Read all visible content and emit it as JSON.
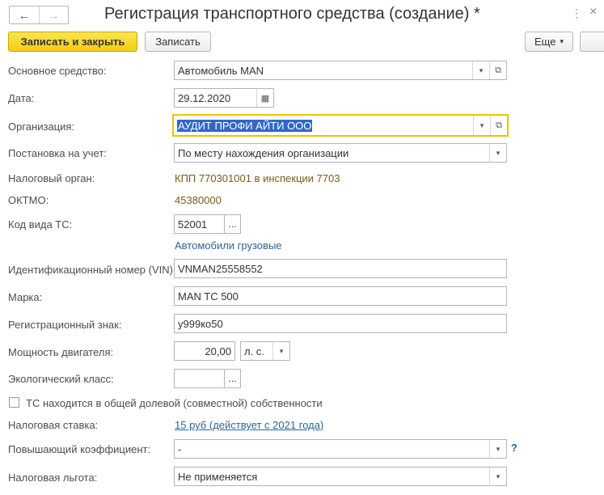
{
  "header": {
    "title": "Регистрация транспортного средства (создание) *",
    "back_icon": "←",
    "forward_icon": "→",
    "more_icon": "⋮",
    "close_icon": "×"
  },
  "toolbar": {
    "save_close_label": "Записать и закрыть",
    "save_label": "Записать",
    "more_label": "Еще",
    "more_arrow": "▾"
  },
  "form": {
    "main_asset": {
      "label": "Основное средство:",
      "value": "Автомобиль MAN"
    },
    "date": {
      "label": "Дата:",
      "value": "29.12.2020"
    },
    "organization": {
      "label": "Организация:",
      "value": "АУДИТ ПРОФИ АЙТИ ООО"
    },
    "registration": {
      "label": "Постановка на учет:",
      "value": "По месту нахождения организации"
    },
    "tax_authority": {
      "label": "Налоговый орган:",
      "value": "КПП 770301001 в инспекции 7703"
    },
    "oktmo": {
      "label": "ОКТМО:",
      "value": "45380000"
    },
    "vehicle_code": {
      "label": "Код вида ТС:",
      "value": "52001",
      "button": "...",
      "description": "Автомобили грузовые"
    },
    "vin": {
      "label": "Идентификационный номер (VIN):",
      "value": "VNMAN25558552"
    },
    "brand": {
      "label": "Марка:",
      "value": "MAN TC 500"
    },
    "reg_sign": {
      "label": "Регистрационный знак:",
      "value": "у999ко50"
    },
    "engine_power": {
      "label": "Мощность двигателя:",
      "value": "20,00",
      "unit": "л. с."
    },
    "eco_class": {
      "label": "Экологический класс:",
      "value": "",
      "button": "..."
    },
    "shared_ownership": {
      "label": "ТС находится в общей долевой (совместной) собственности",
      "checked": false
    },
    "tax_rate": {
      "label": "Налоговая ставка:",
      "value": "15 руб (действует с 2021 года)"
    },
    "coefficient": {
      "label": "Повышающий коэффициент:",
      "value": "-",
      "help": "?"
    },
    "tax_benefit": {
      "label": "Налоговая льгота:",
      "value": "Не применяется"
    }
  },
  "icons": {
    "dropdown": "▾",
    "open": "⧉",
    "calendar": "▦"
  },
  "colors": {
    "primary_button": "#f2cd14",
    "focus_border": "#f2c200",
    "link": "#2d6596",
    "brown_text": "#7a5a1e",
    "selection": "#3367c5"
  }
}
